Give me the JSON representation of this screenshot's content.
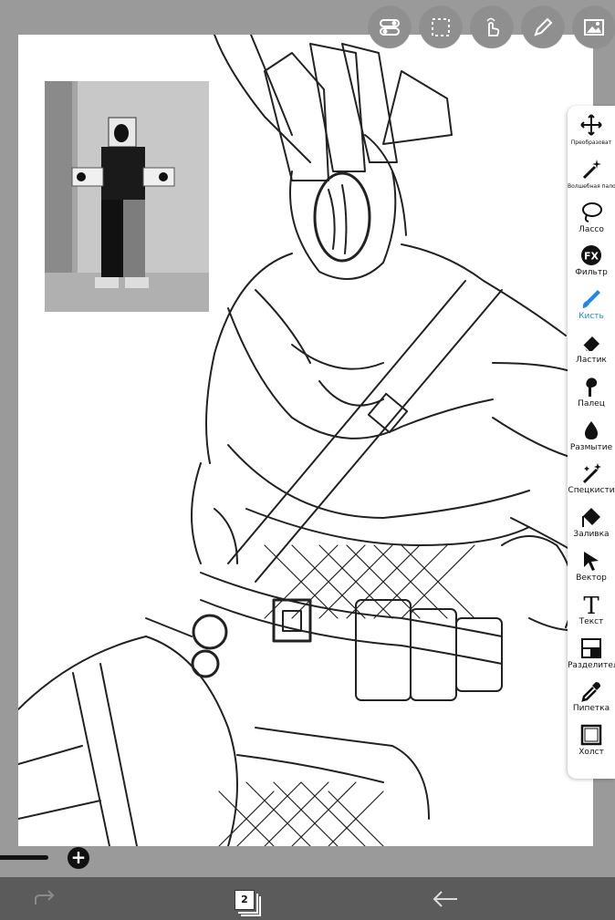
{
  "top_toolbar": {
    "buttons": [
      {
        "id": "toggle",
        "icon": "toggle-icon"
      },
      {
        "id": "selection",
        "icon": "selection-icon"
      },
      {
        "id": "touch",
        "icon": "touch-icon"
      },
      {
        "id": "pen",
        "icon": "pen-icon"
      },
      {
        "id": "image",
        "icon": "image-icon"
      }
    ]
  },
  "tools": [
    {
      "label": "Преобразоват",
      "icon": "transform-icon",
      "active": false,
      "small": true
    },
    {
      "label": "Волшебная палочка",
      "icon": "magic-wand-icon",
      "active": false,
      "small": true
    },
    {
      "label": "Лассо",
      "icon": "lasso-icon",
      "active": false
    },
    {
      "label": "Фильтр",
      "icon": "filter-fx-icon",
      "active": false
    },
    {
      "label": "Кисть",
      "icon": "brush-icon",
      "active": true
    },
    {
      "label": "Ластик",
      "icon": "eraser-icon",
      "active": false
    },
    {
      "label": "Палец",
      "icon": "smudge-icon",
      "active": false
    },
    {
      "label": "Размытие",
      "icon": "blur-icon",
      "active": false
    },
    {
      "label": "Спецкисти",
      "icon": "special-brush-icon",
      "active": false
    },
    {
      "label": "Заливка",
      "icon": "fill-icon",
      "active": false
    },
    {
      "label": "Вектор",
      "icon": "vector-icon",
      "active": false
    },
    {
      "label": "Текст",
      "icon": "text-icon",
      "active": false
    },
    {
      "label": "Разделитель",
      "icon": "divider-icon",
      "active": false
    },
    {
      "label": "Пипетка",
      "icon": "eyedropper-icon",
      "active": false
    },
    {
      "label": "Холст",
      "icon": "canvas-icon",
      "active": false
    }
  ],
  "bottom_bar": {
    "layer_count": "2"
  },
  "colors": {
    "accent": "#1e88e5",
    "background": "#9a9a9a",
    "bottom_bar": "#5b5b5b"
  }
}
